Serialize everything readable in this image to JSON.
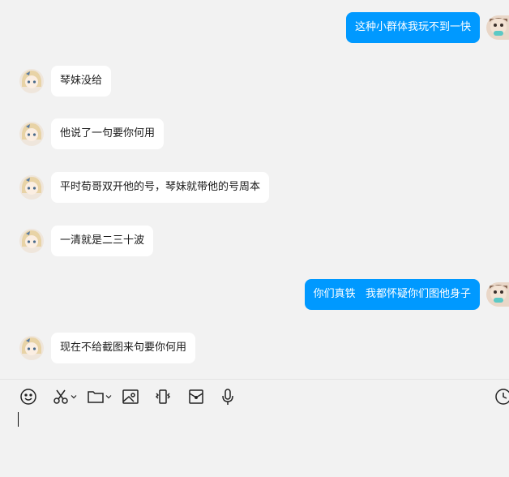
{
  "messages": [
    {
      "direction": "out",
      "text": "这种小群体我玩不到一快"
    },
    {
      "direction": "in",
      "text": "琴妹没给"
    },
    {
      "direction": "in",
      "text": "他说了一句要你何用"
    },
    {
      "direction": "in",
      "text": "平时荀哥双开他的号，琴妹就带他的号周本"
    },
    {
      "direction": "in",
      "text": "一清就是二三十波"
    },
    {
      "direction": "out",
      "text": "你们真铁   我都怀疑你们图他身子"
    },
    {
      "direction": "in",
      "text": "现在不给截图来句要你何用"
    }
  ],
  "toolbar": {
    "icons": [
      "emoji-icon",
      "scissors-icon",
      "folder-icon",
      "image-icon",
      "shake-icon",
      "red-packet-icon",
      "microphone-icon",
      "history-clock-icon"
    ]
  },
  "colors": {
    "outgoing_bubble": "#0099ff",
    "incoming_bubble": "#ffffff",
    "background": "#f2f2f2"
  }
}
